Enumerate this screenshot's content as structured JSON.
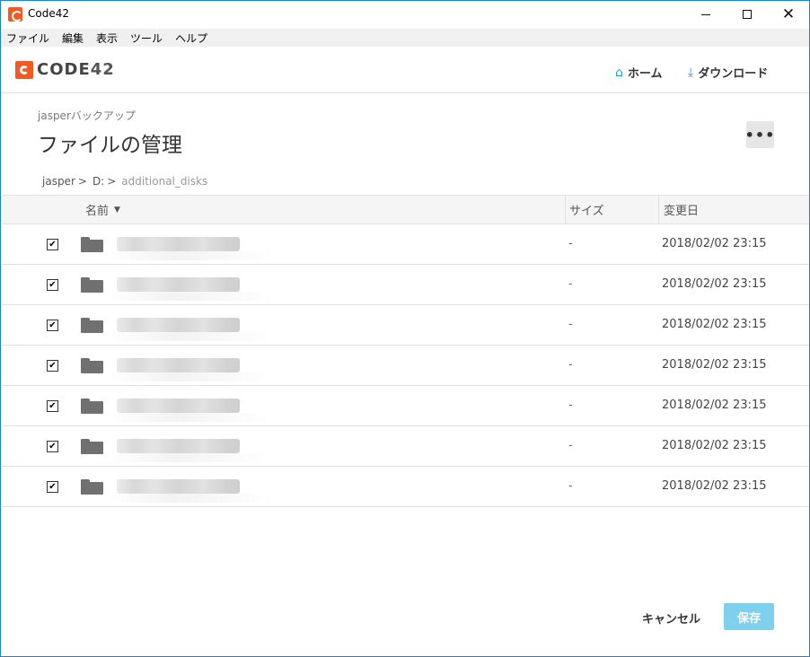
{
  "window": {
    "title": "Code42",
    "controls": {
      "minimize_icon": "minimize-icon",
      "maximize_icon": "maximize-icon",
      "close_icon": "close-icon"
    }
  },
  "menubar": {
    "items": [
      {
        "label": "ファイル"
      },
      {
        "label": "編集"
      },
      {
        "label": "表示"
      },
      {
        "label": "ツール"
      },
      {
        "label": "ヘルプ"
      }
    ]
  },
  "header": {
    "logo_text": "CODE",
    "logo_number": "42",
    "nav": {
      "home_label": "ホーム",
      "home_icon": "home-icon",
      "download_label": "ダウンロード",
      "download_icon": "download-icon"
    }
  },
  "page": {
    "subtitle": "jasperバックアップ",
    "title": "ファイルの管理",
    "more_button_label": "•••"
  },
  "breadcrumb": {
    "items": [
      {
        "label": "jasper"
      },
      {
        "label": "D:"
      },
      {
        "label": "additional_disks"
      }
    ],
    "separator": ">"
  },
  "table": {
    "columns": {
      "name": "名前",
      "size": "サイズ",
      "date": "変更日"
    },
    "sort_icon": "sort-desc-icon",
    "rows": [
      {
        "checked": true,
        "checkmark": "✔",
        "type": "folder",
        "name_redacted": true,
        "size": "-",
        "modified": "2018/02/02 23:15"
      },
      {
        "checked": true,
        "checkmark": "✔",
        "type": "folder",
        "name_redacted": true,
        "size": "-",
        "modified": "2018/02/02 23:15"
      },
      {
        "checked": true,
        "checkmark": "✔",
        "type": "folder",
        "name_redacted": true,
        "size": "-",
        "modified": "2018/02/02 23:15"
      },
      {
        "checked": true,
        "checkmark": "✔",
        "type": "folder",
        "name_redacted": true,
        "size": "-",
        "modified": "2018/02/02 23:15"
      },
      {
        "checked": true,
        "checkmark": "✔",
        "type": "folder",
        "name_redacted": true,
        "size": "-",
        "modified": "2018/02/02 23:15"
      },
      {
        "checked": true,
        "checkmark": "✔",
        "type": "folder",
        "name_redacted": true,
        "size": "-",
        "modified": "2018/02/02 23:15"
      },
      {
        "checked": true,
        "checkmark": "✔",
        "type": "folder",
        "name_redacted": true,
        "size": "-",
        "modified": "2018/02/02 23:15"
      }
    ]
  },
  "footer": {
    "cancel_label": "キャンセル",
    "save_label": "保存"
  },
  "colors": {
    "brand": "#f15a22",
    "accent": "#2a9fd6",
    "save_button_disabled": "#7fd0ec",
    "window_border": "#1883d7"
  }
}
